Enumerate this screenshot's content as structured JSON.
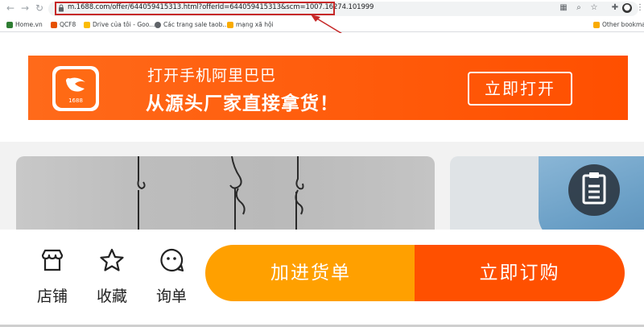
{
  "browser": {
    "url": "m.1688.com/offer/644059415313.html?offerId=644059415313&scm=1007.16274.101999",
    "bookmarks": [
      {
        "label": "Home.vn",
        "color": "#2e7d32"
      },
      {
        "label": "QCF8",
        "color": "#e65100"
      },
      {
        "label": "Drive của tôi - Goo...",
        "color": "#fbbc04"
      },
      {
        "label": "Các trang sale taob...",
        "color": "#5f6368"
      },
      {
        "label": "mạng xã hội",
        "color": "#f9ab00"
      }
    ],
    "other_bookmarks": "Other bookmark"
  },
  "banner": {
    "line1": "打开手机阿里巴巴",
    "line2": "从源头厂家直接拿货！",
    "logo_text": "1688",
    "open_button": "立即打开"
  },
  "bottombar": {
    "items": [
      {
        "label": "店铺",
        "icon": "store-icon"
      },
      {
        "label": "收藏",
        "icon": "star-icon"
      },
      {
        "label": "询单",
        "icon": "chat-icon"
      }
    ],
    "add_to_cart": "加进货单",
    "buy_now": "立即订购"
  },
  "colors": {
    "brand_orange": "#ff5000",
    "cart_yellow": "#ffa000",
    "annotation_red": "#c62828"
  }
}
